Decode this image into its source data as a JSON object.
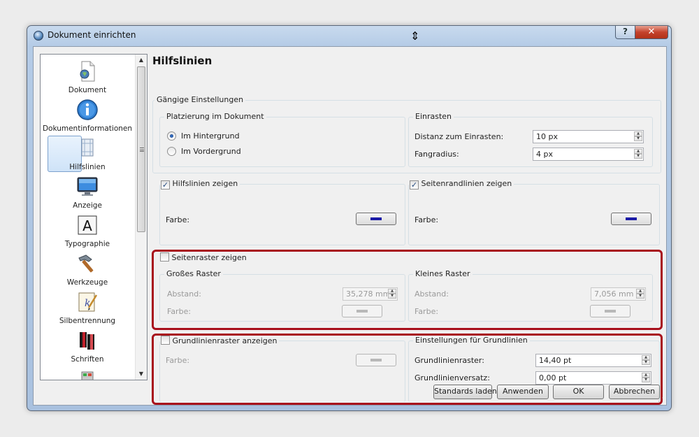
{
  "window": {
    "title": "Dokument einrichten",
    "help_label": "?",
    "close_label": "✕"
  },
  "sidebar": {
    "items": [
      {
        "label": "Dokument",
        "icon": "document-icon"
      },
      {
        "label": "Dokumentinformationen",
        "icon": "info-icon"
      },
      {
        "label": "Hilfslinien",
        "icon": "guides-icon",
        "selected": true
      },
      {
        "label": "Anzeige",
        "icon": "monitor-icon"
      },
      {
        "label": "Typographie",
        "icon": "typography-icon"
      },
      {
        "label": "Werkzeuge",
        "icon": "hammer-icon"
      },
      {
        "label": "Silbentrennung",
        "icon": "hyphenation-icon"
      },
      {
        "label": "Schriften",
        "icon": "fonts-icon"
      }
    ]
  },
  "panel": {
    "title": "Hilfslinien",
    "common": {
      "legend": "Gängige Einstellungen",
      "placement": {
        "legend": "Platzierung im Dokument",
        "options": [
          "Im Hintergrund",
          "Im Vordergrund"
        ],
        "selected": "Im Hintergrund"
      },
      "snap": {
        "legend": "Einrasten",
        "distance_label": "Distanz zum Einrasten:",
        "distance_value": "10 px",
        "radius_label": "Fangradius:",
        "radius_value": "4 px"
      }
    },
    "guides": {
      "label": "Hilfslinien zeigen",
      "checked": true,
      "color_label": "Farbe:",
      "color": "#1a1aa6"
    },
    "margins": {
      "label": "Seitenrandlinien zeigen",
      "checked": true,
      "color_label": "Farbe:",
      "color": "#1a1aa6"
    },
    "grid": {
      "label": "Seitenraster zeigen",
      "checked": false,
      "major": {
        "legend": "Großes Raster",
        "spacing_label": "Abstand:",
        "spacing_value": "35,278 mm",
        "color_label": "Farbe:"
      },
      "minor": {
        "legend": "Kleines Raster",
        "spacing_label": "Abstand:",
        "spacing_value": "7,056 mm",
        "color_label": "Farbe:"
      }
    },
    "baseline": {
      "label": "Grundlinienraster anzeigen",
      "checked": false,
      "color_label": "Farbe:",
      "settings": {
        "legend": "Einstellungen für Grundlinien",
        "grid_label": "Grundlinienraster:",
        "grid_value": "14,40 pt",
        "offset_label": "Grundlinienversatz:",
        "offset_value": "0,00 pt"
      }
    }
  },
  "buttons": {
    "defaults": "Standards laden",
    "apply": "Anwenden",
    "ok": "OK",
    "cancel": "Abbrechen"
  },
  "colors": {
    "highlight": "#a8101c",
    "guide_color": "#1a1aa6"
  }
}
